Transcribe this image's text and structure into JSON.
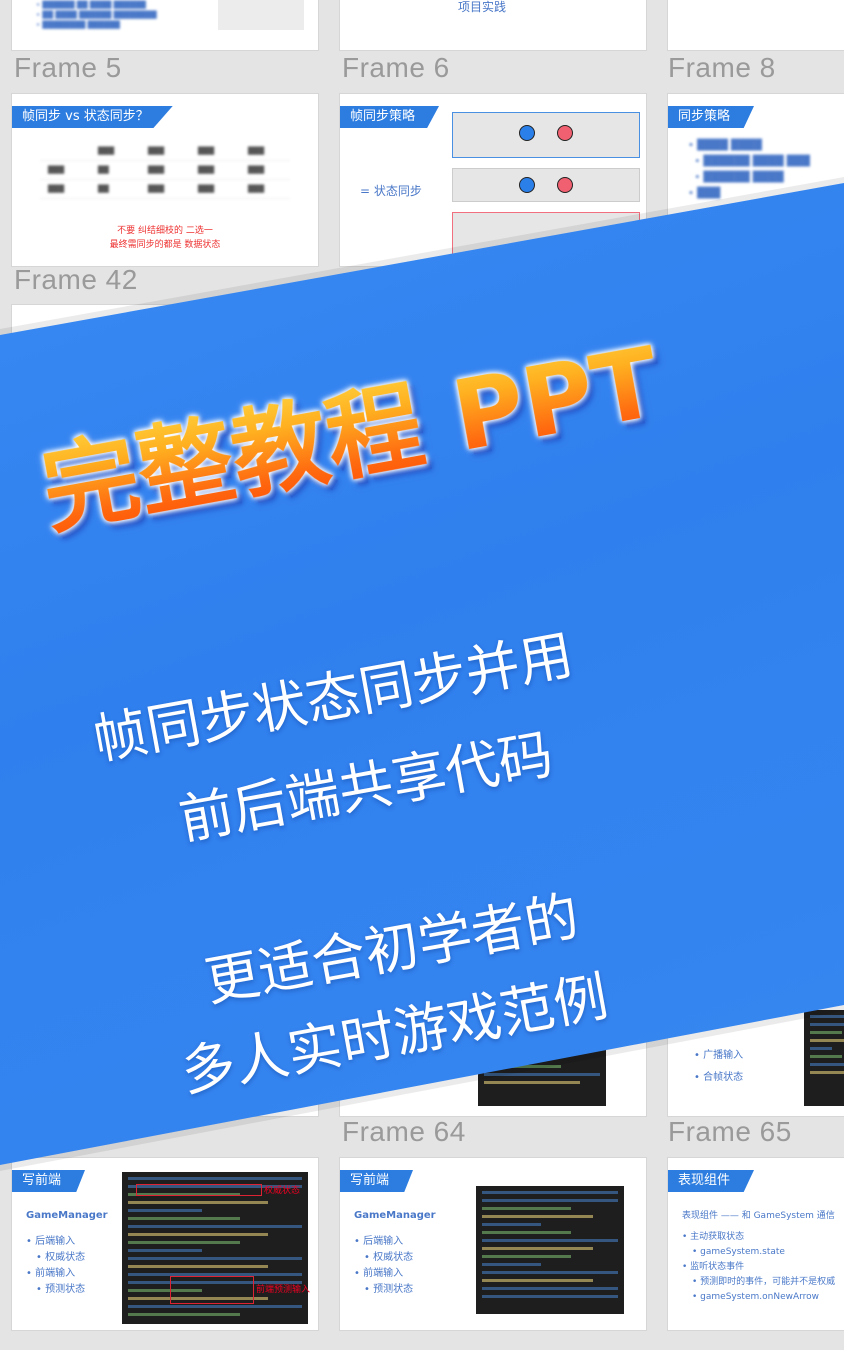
{
  "frames": {
    "f5": "Frame 5",
    "f6": "Frame 6",
    "f8": "Frame 8",
    "f42": "Frame 42",
    "f64": "Frame 64",
    "f65": "Frame 65"
  },
  "slides": {
    "s1_title": "帧同步 vs 状态同步？",
    "s1_note1": "不要 纠结细枝的 二选一",
    "s1_note2": "最终需同步的都是 数据状态",
    "s2_title": "帧同步策略",
    "s2_label": "= 状态同步",
    "s3_title": "同步策略",
    "s4_title": "写前端",
    "s4_sub": "GameManager",
    "s4_b1": "• 后端输入",
    "s4_b2": "• 权威状态",
    "s4_b3": "• 前端输入",
    "s4_b4": "• 预测状态",
    "s4_ann1": "权威状态",
    "s4_ann2": "前端预测输入",
    "s5_title": "写前端",
    "s5_sub": "GameManager",
    "s6_title": "表现组件",
    "s6_line": "表现组件 —— 和 GameSystem 通信",
    "s6_b1": "• 主动获取状态",
    "s6_b2": "• gameSystem.state",
    "s6_b3": "• 监听状态事件",
    "s6_b4": "• 预测即时的事件，可能并不是权威",
    "s6_b5": "• gameSystem.onNewArrow",
    "mid_b1": "• 广播输入",
    "mid_b2": "• 合帧状态",
    "top_text": "项目实践"
  },
  "banner": {
    "title": "完整教程 PPT",
    "line1": "帧同步状态同步并用",
    "line2": "前后端共享代码",
    "line3": "更适合初学者的",
    "line4": "多人实时游戏范例"
  },
  "colors": {
    "banner": "#3a8af2",
    "title_top": "#ffe14a",
    "title_bottom": "#ff4a00",
    "slide_tag": "#2d7de0"
  }
}
